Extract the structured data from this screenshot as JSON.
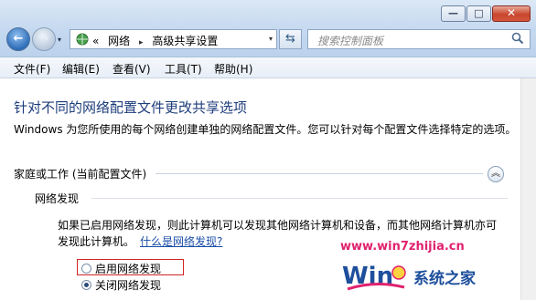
{
  "window": {
    "minimize_glyph": "—",
    "maximize_glyph": "□",
    "close_glyph": "✕"
  },
  "nav": {
    "back_glyph": "←",
    "forward_glyph": "→",
    "dropdown_glyph": "▾"
  },
  "address": {
    "overflow": "«",
    "crumb_1": "网络",
    "separator": "▸",
    "crumb_2": "高级共享设置",
    "drop_glyph": "▾",
    "icon": "network-icon"
  },
  "refresh_glyph": "⇆",
  "search": {
    "placeholder": "搜索控制面板",
    "icon": "search-icon"
  },
  "menu": [
    {
      "label": "文件(F)"
    },
    {
      "label": "编辑(E)"
    },
    {
      "label": "查看(V)"
    },
    {
      "label": "工具(T)"
    },
    {
      "label": "帮助(H)"
    }
  ],
  "main": {
    "title": "针对不同的网络配置文件更改共享选项",
    "description": "Windows 为您所使用的每个网络创建单独的网络配置文件。您可以针对每个配置文件选择特定的选项。",
    "profile_label": "家庭或工作 (当前配置文件)",
    "collapse_glyph": "︽",
    "network_discovery_label": "网络发现",
    "network_discovery_text": "如果已启用网络发现，则此计算机可以发现其他网络计算机和设备，而其他网络计算机亦可发现此计算机。",
    "network_discovery_link": "什么是网络发现?",
    "option_enable": "启用网络发现",
    "option_disable": "关闭网络发现",
    "selected_option": "关闭网络发现"
  },
  "watermark": {
    "brand": "www.win7zhijia.cn",
    "site_text": "系统之家",
    "logo_text": "Win"
  },
  "colors": {
    "title_blue": "#1e3d7b",
    "link_blue": "#1a4ea8",
    "highlight_red": "#d22323",
    "watermark_pink": "#e0226e",
    "watermark_blue": "#1e4f9c"
  }
}
